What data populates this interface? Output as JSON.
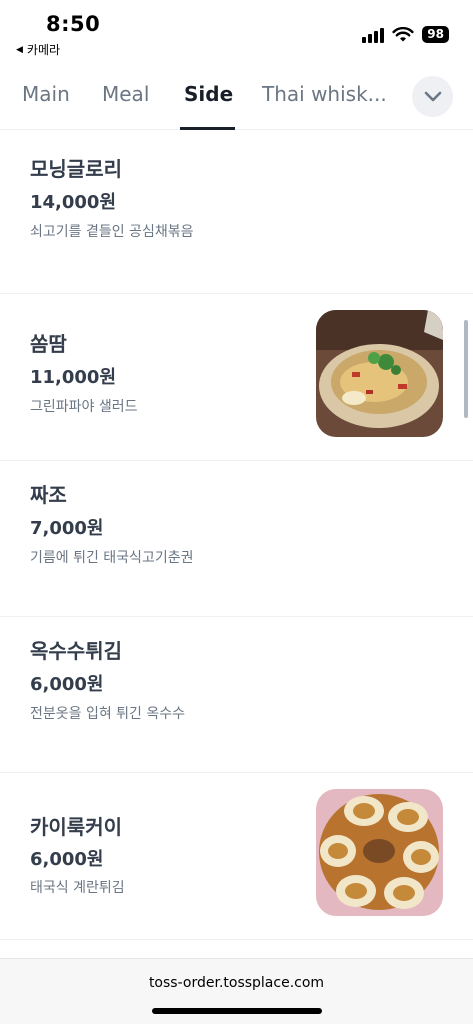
{
  "status_bar": {
    "time": "8:50",
    "back_app": "카메라",
    "battery": "98"
  },
  "tabs": [
    {
      "label": "Main",
      "active": false
    },
    {
      "label": "Meal",
      "active": false
    },
    {
      "label": "Side",
      "active": true
    },
    {
      "label": "Thai whisk...",
      "active": false
    }
  ],
  "menu_items": [
    {
      "name": "모닝글로리",
      "price": "14,000원",
      "description": "쇠고기를 곁들인 공심채볶음",
      "has_image": false
    },
    {
      "name": "쏨땀",
      "price": "11,000원",
      "description": "그린파파야 샐러드",
      "has_image": true
    },
    {
      "name": "짜조",
      "price": "7,000원",
      "description": "기름에 튀긴 태국식고기춘권",
      "has_image": false
    },
    {
      "name": "옥수수튀김",
      "price": "6,000원",
      "description": "전분옷을 입혀 튀긴 옥수수",
      "has_image": false
    },
    {
      "name": "카이룩커이",
      "price": "6,000원",
      "description": "태국식 계란튀김",
      "has_image": true
    }
  ],
  "url_bar": {
    "url": "toss-order.tossplace.com"
  }
}
